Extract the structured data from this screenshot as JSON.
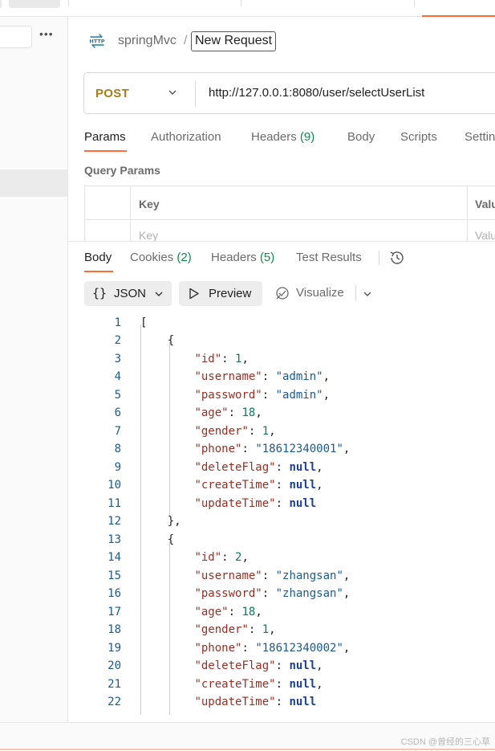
{
  "request": {
    "collection": "springMvc",
    "separator": "/",
    "name": "New Request",
    "method": "POST",
    "url": "http://127.0.0.1:8080/user/selectUserList"
  },
  "request_tabs": [
    {
      "label": "Params",
      "count": ""
    },
    {
      "label": "Authorization",
      "count": ""
    },
    {
      "label": "Headers",
      "count": "(9)"
    },
    {
      "label": "Body",
      "count": ""
    },
    {
      "label": "Scripts",
      "count": ""
    },
    {
      "label": "Settin",
      "count": ""
    }
  ],
  "query_params": {
    "title": "Query Params",
    "key_header": "Key",
    "value_header": "Valu",
    "key_placeholder": "Key",
    "value_placeholder": "Valu"
  },
  "response_tabs": [
    {
      "label": "Body",
      "count": ""
    },
    {
      "label": "Cookies",
      "count": "(2)"
    },
    {
      "label": "Headers",
      "count": "(5)"
    },
    {
      "label": "Test Results",
      "count": ""
    }
  ],
  "format": {
    "json_label": "JSON",
    "preview_label": "Preview",
    "visualize_label": "Visualize"
  },
  "code_lines": [
    "1",
    "2",
    "3",
    "4",
    "5",
    "6",
    "7",
    "8",
    "9",
    "10",
    "11",
    "12",
    "13",
    "14",
    "15",
    "16",
    "17",
    "18",
    "19",
    "20",
    "21",
    "22"
  ],
  "users": [
    {
      "id": "1",
      "username": "\"admin\"",
      "password": "\"admin\"",
      "age": "18",
      "gender": "1",
      "phone": "\"18612340001\"",
      "deleteFlag": "null",
      "createTime": "null",
      "updateTime": "null"
    },
    {
      "id": "2",
      "username": "\"zhangsan\"",
      "password": "\"zhangsan\"",
      "age": "18",
      "gender": "1",
      "phone": "\"18612340002\"",
      "deleteFlag": "null",
      "createTime": "null",
      "updateTime": "null"
    }
  ],
  "watermark": "CSDN @曾经的三心草",
  "colors": {
    "accent": "#ff6c37",
    "method": "#a67c16",
    "count": "#0f8a4f"
  }
}
